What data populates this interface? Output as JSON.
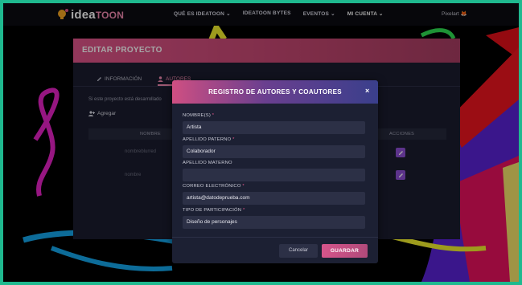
{
  "nav": {
    "logo_text": "idea",
    "logo_text_accent": "TOON",
    "items": [
      {
        "label": "QUÉ ES IDEATOON ⌄"
      },
      {
        "label": "IDEATOON BYTES"
      },
      {
        "label": "EVENTOS ⌄"
      },
      {
        "label": "MI CUENTA ⌄"
      }
    ],
    "right_text": "Pixelart 🦊"
  },
  "page": {
    "title": "EDITAR PROYECTO",
    "tabs": [
      {
        "label": "INFORMACIÓN",
        "icon": "edit-icon"
      },
      {
        "label": "AUTORES",
        "icon": "user-icon"
      }
    ],
    "note": "Si este proyecto está desarrollado",
    "add_label": "Agregar",
    "table_headers": {
      "name": "NOMBRE",
      "actions": "ACCIONES"
    },
    "rows": [
      {
        "name": "nombreblurred"
      },
      {
        "name": "nombre"
      }
    ]
  },
  "modal": {
    "title": "REGISTRO DE AUTORES Y COAUTORES",
    "close": "×",
    "fields": [
      {
        "label": "NOMBRE(S)",
        "required": true,
        "value": "Artista"
      },
      {
        "label": "APELLIDO PATERNO",
        "required": true,
        "value": "Colaborador"
      },
      {
        "label": "APELLIDO MATERNO",
        "required": false,
        "value": ""
      },
      {
        "label": "CORREO ELECTRÓNICO",
        "required": true,
        "value": "artista@datodeprueba.com"
      },
      {
        "label": "TIPO DE PARTICIPACIÓN",
        "required": true,
        "value": "Diseño de personajes"
      }
    ],
    "required_mark": "*",
    "cancel_label": "Cancelar",
    "save_label": "GUARDAR"
  },
  "colors": {
    "accent": "#e0558a",
    "purple": "#8e4fd6",
    "frame": "#1fb98f"
  }
}
